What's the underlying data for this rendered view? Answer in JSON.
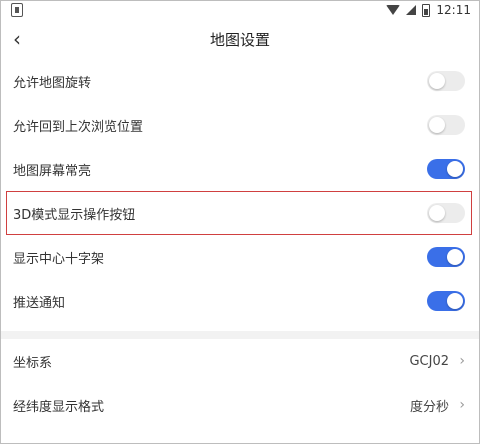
{
  "status_bar": {
    "time": "12:11"
  },
  "header": {
    "title": "地图设置",
    "back_symbol": "‹"
  },
  "toggles": [
    {
      "label": "允许地图旋转",
      "on": false
    },
    {
      "label": "允许回到上次浏览位置",
      "on": false
    },
    {
      "label": "地图屏幕常亮",
      "on": true
    },
    {
      "label": "3D模式显示操作按钮",
      "on": false,
      "highlighted": true
    },
    {
      "label": "显示中心十字架",
      "on": true
    },
    {
      "label": "推送通知",
      "on": true
    }
  ],
  "nav_items": [
    {
      "label": "坐标系",
      "value": "GCJ02"
    },
    {
      "label": "经纬度显示格式",
      "value": "度分秒"
    }
  ],
  "colors": {
    "accent": "#3a6fe8",
    "highlight_border": "#d04040",
    "toggle_off": "#ececec"
  },
  "icons": {
    "back": "back-arrow-icon",
    "chevron": "chevron-right-icon"
  }
}
